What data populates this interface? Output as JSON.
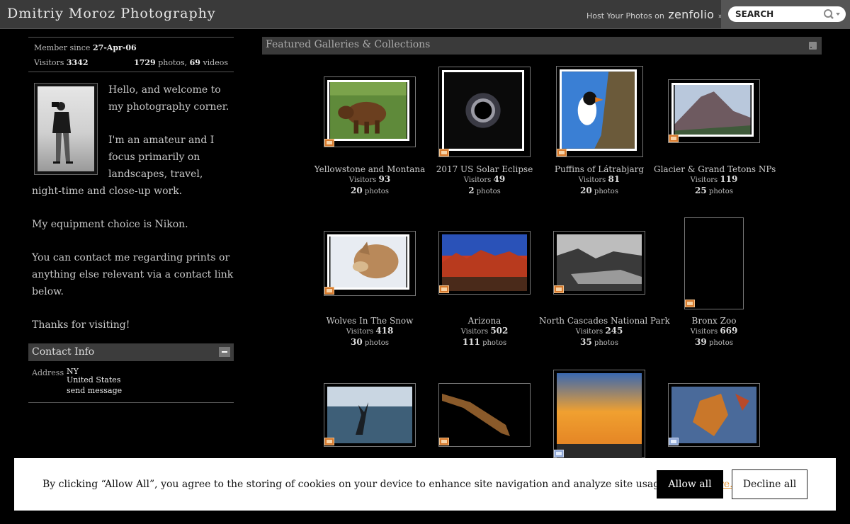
{
  "header": {
    "site_title": "Dmitriy Moroz Photography",
    "host_text": "Host Your Photos on",
    "host_brand": "zenfolio",
    "host_arrow": "»",
    "search_placeholder": "SEARCH"
  },
  "profile": {
    "member_since_label": "Member since",
    "member_since_value": "27-Apr-06",
    "visitors_label": "Visitors",
    "visitors_value": "3342",
    "photos_count": "1729",
    "photos_label": "photos,",
    "videos_count": "69",
    "videos_label": "videos",
    "bio": [
      "Hello, and welcome to my photography corner.",
      "I'm an amateur and I focus primarily on landscapes, travel, night-time and close-up work.",
      "My equipment choice is Nikon.",
      "You can contact me regarding prints or anything else relevant via a contact link below.",
      "Thanks for visiting!"
    ]
  },
  "contact": {
    "heading": "Contact Info",
    "address_label": "Address",
    "address_lines": [
      "NY",
      "United States",
      "send message"
    ]
  },
  "featured": {
    "heading": "Featured Galleries & Collections",
    "visitors_label": "Visitors",
    "photos_label": "photos",
    "galleries": [
      {
        "title": "Yellowstone and Montana",
        "visitors": "93",
        "photos": "20"
      },
      {
        "title": "2017 US Solar Eclipse",
        "visitors": "49",
        "photos": "2"
      },
      {
        "title": "Puffins of Látrabjarg",
        "visitors": "81",
        "photos": "20"
      },
      {
        "title": "Glacier & Grand Tetons NPs",
        "visitors": "119",
        "photos": "25"
      },
      {
        "title": "Wolves In The Snow",
        "visitors": "418",
        "photos": "30"
      },
      {
        "title": "Arizona",
        "visitors": "502",
        "photos": "111"
      },
      {
        "title": "North Cascades National Park",
        "visitors": "245",
        "photos": "35"
      },
      {
        "title": "Bronx Zoo",
        "visitors": "669",
        "photos": "39"
      }
    ]
  },
  "cookie": {
    "text": "By clicking “Allow All”, you agree to the storing of cookies on your device to enhance site navigation and analyze site usage.",
    "link": "Show more.",
    "allow": "Allow all",
    "decline": "Decline all"
  },
  "colors": {
    "background": "#000000",
    "bar": "#3a3a3a",
    "link_orange": "#e69a3c"
  }
}
